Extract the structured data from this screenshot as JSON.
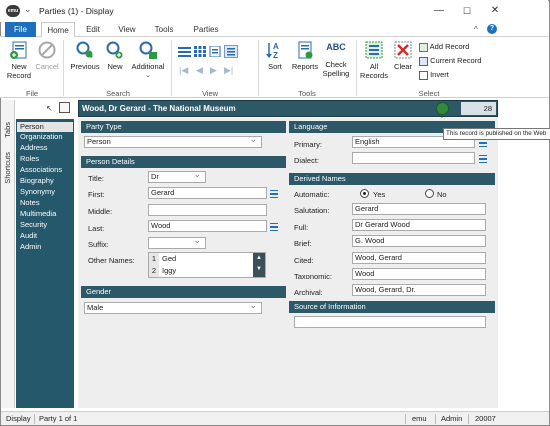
{
  "window": {
    "title": "Parties (1) - Display",
    "app_icon": "emu",
    "controls": [
      "minimize-icon",
      "maximize-icon",
      "close-icon"
    ]
  },
  "ribbon_tabs": [
    "File",
    "Home",
    "Edit",
    "View",
    "Tools",
    "Parties"
  ],
  "ribbon": {
    "file_group": {
      "label": "File",
      "new_record": "New\nRecord",
      "cancel": "Cancel"
    },
    "search_group": {
      "label": "Search",
      "previous": "Previous",
      "new": "New",
      "additional": "Additional"
    },
    "view_group": {
      "label": "View"
    },
    "tools_group": {
      "label": "Tools",
      "sort": "Sort",
      "reports": "Reports",
      "check_spelling": "Check\nSpelling",
      "abc": "ABC"
    },
    "select_group": {
      "label": "Select",
      "all_records": "All\nRecords",
      "clear": "Clear",
      "add_record": "Add Record",
      "current_record": "Current Record",
      "invert": "Invert"
    }
  },
  "side_tabs": [
    "Tabs",
    "Shortcuts"
  ],
  "nav": {
    "items": [
      "Person",
      "Organization",
      "Address",
      "Roles",
      "Associations",
      "Biography",
      "Synonymy",
      "Notes",
      "Multimedia",
      "Security",
      "Audit",
      "Admin"
    ],
    "selected": "Person"
  },
  "record": {
    "title": "Wood, Dr Gerard - The National Museum",
    "number": "28",
    "tooltip": "This record is published on the Web"
  },
  "party_type": {
    "section": "Party Type",
    "value": "Person"
  },
  "person_details": {
    "section": "Person Details",
    "title_label": "Title:",
    "title_value": "Dr",
    "first_label": "First:",
    "first_value": "Gerard",
    "middle_label": "Middle:",
    "middle_value": "",
    "last_label": "Last:",
    "last_value": "Wood",
    "suffix_label": "Suffix:",
    "suffix_value": "",
    "other_label": "Other Names:",
    "other_names": [
      {
        "n": "1",
        "v": "Ged"
      },
      {
        "n": "2",
        "v": "Iggy"
      }
    ]
  },
  "gender": {
    "section": "Gender",
    "value": "Male"
  },
  "language": {
    "section": "Language",
    "primary_label": "Primary:",
    "primary_value": "English",
    "dialect_label": "Dialect:",
    "dialect_value": ""
  },
  "derived": {
    "section": "Derived Names",
    "automatic_label": "Automatic:",
    "yes": "Yes",
    "no": "No",
    "automatic_value": "Yes",
    "salutation_label": "Salutation:",
    "salutation": "Gerard",
    "full_label": "Full:",
    "full": "Dr Gerard Wood",
    "brief_label": "Brief:",
    "brief": "G. Wood",
    "cited_label": "Cited:",
    "cited": "Wood, Gerard",
    "taxonomic_label": "Taxonomic:",
    "taxonomic": "Wood",
    "archival_label": "Archival:",
    "archival": "Wood, Gerard, Dr."
  },
  "source": {
    "section": "Source of Information",
    "value": ""
  },
  "status": {
    "mode": "Display",
    "page": "Party 1 of 1",
    "system": "emu",
    "user": "Admin",
    "code": "20007"
  }
}
